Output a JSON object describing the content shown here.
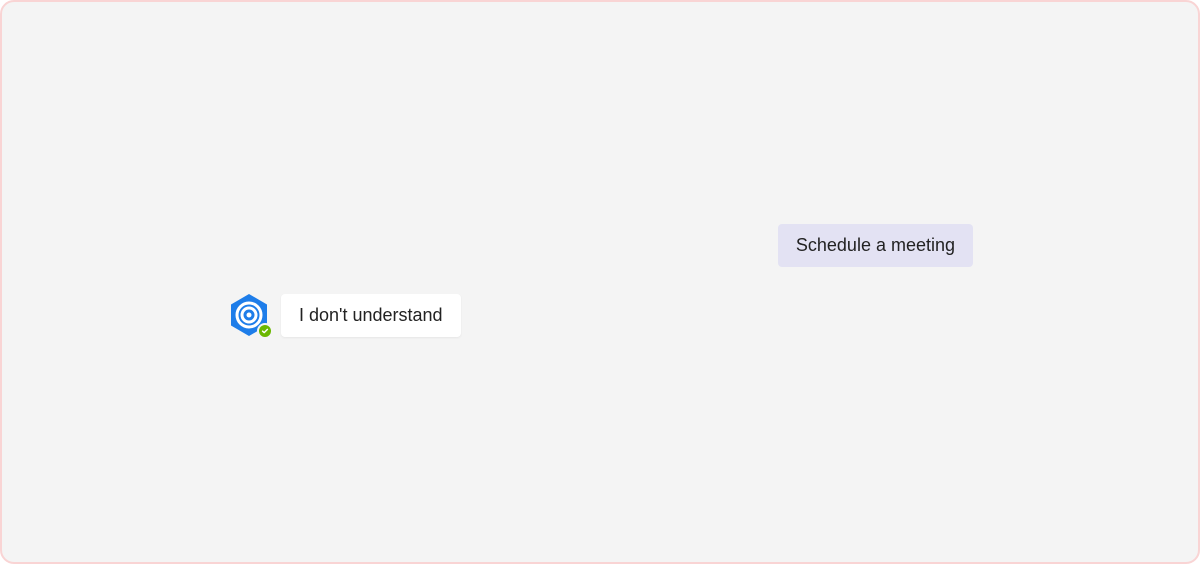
{
  "chat": {
    "user_message": "Schedule a meeting",
    "bot_message": "I don't understand"
  },
  "colors": {
    "frame_border": "#f9d4d4",
    "frame_bg": "#f4f4f4",
    "user_bubble_bg": "#e3e2f3",
    "bot_bubble_bg": "#ffffff",
    "bot_avatar_primary": "#1e7de9",
    "presence_available": "#6bb700"
  },
  "icons": {
    "bot_avatar": "hexagon-swirl-icon",
    "presence": "checkmark-icon"
  }
}
